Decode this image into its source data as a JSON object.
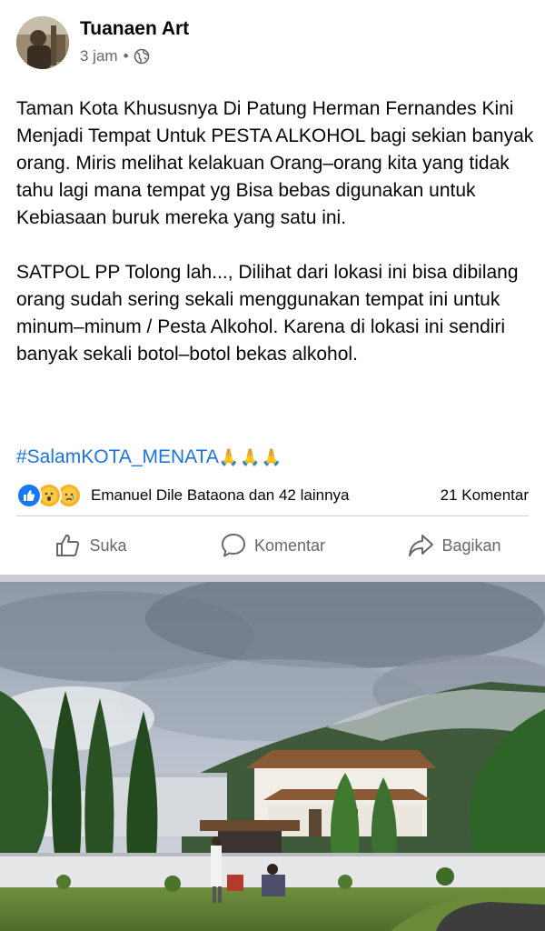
{
  "post": {
    "author": "Tuanaen Art",
    "time": "3 jam",
    "dot": "•",
    "paragraph1": "Taman Kota Khususnya Di Patung Herman Fernandes Kini Menjadi Tempat Untuk PESTA ALKOHOL bagi sekian banyak orang. Miris melihat kelakuan Orang–orang kita yang tidak tahu lagi mana tempat yg Bisa bebas digunakan untuk Kebiasaan buruk mereka yang satu ini.",
    "paragraph2": "SATPOL PP Tolong lah..., Dilihat dari lokasi ini bisa dibilang orang sudah sering sekali menggunakan tempat ini untuk minum–minum / Pesta Alkohol. Karena di lokasi ini sendiri banyak sekali botol–botol bekas alkohol.",
    "hashtag": "#SalamKOTA_MENATA",
    "hashtag_emoji": "🙏🙏🙏"
  },
  "reactions": {
    "icons": [
      "like-icon",
      "wow-icon",
      "sad-icon"
    ],
    "names": "Emanuel Dile Bataona dan 42 lainnya",
    "comments": "21 Komentar"
  },
  "actions": {
    "like_label": "Suka",
    "comment_label": "Komentar",
    "share_label": "Bagikan"
  },
  "colors": {
    "link": "#1b74e4",
    "secondary_text": "#65676b",
    "like_blue": "#1877f2"
  }
}
